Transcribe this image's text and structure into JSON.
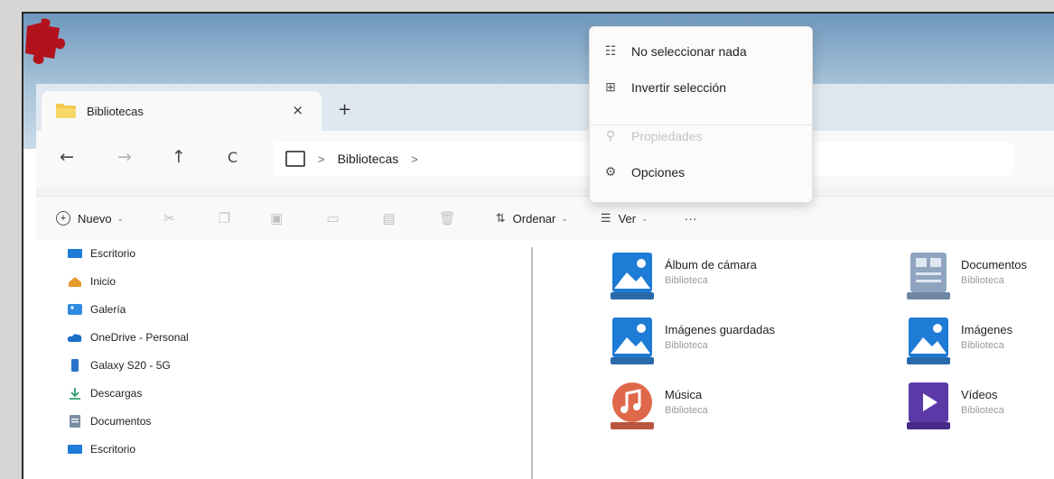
{
  "window": {
    "tab_title": "Bibliotecas",
    "tab_close": "×",
    "tab_new": "+"
  },
  "nav": {
    "back": "←",
    "forward": "→",
    "up": "↑",
    "refresh": "C",
    "breadcrumb": "Bibliotecas",
    "breadcrumb_sep": ">",
    "breadcrumb_end": ">"
  },
  "toolbar": {
    "new_label": "Nuevo",
    "sort_label": "Ordenar",
    "view_label": "Ver",
    "more_label": "···"
  },
  "context_menu": {
    "items": [
      {
        "label": "No seleccionar nada",
        "icon": "select-none-icon",
        "enabled": true
      },
      {
        "label": "Invertir selección",
        "icon": "invert-selection-icon",
        "enabled": true
      },
      {
        "label": "Propiedades",
        "icon": "properties-icon",
        "enabled": false
      },
      {
        "label": "Opciones",
        "icon": "gear-icon",
        "enabled": true
      }
    ]
  },
  "sidebar": {
    "items": [
      {
        "label": "Escritorio",
        "icon": "desktop-icon",
        "color": "#1e7bd6"
      },
      {
        "label": "Inicio",
        "icon": "home-icon",
        "color": "#e59b2b"
      },
      {
        "label": "Galería",
        "icon": "gallery-icon",
        "color": "#2f8be0"
      },
      {
        "label": "OneDrive - Personal",
        "icon": "cloud-icon",
        "color": "#1b6fc7"
      },
      {
        "label": "Galaxy S20 - 5G",
        "icon": "phone-icon",
        "color": "#2a72c9"
      },
      {
        "label": "Descargas",
        "icon": "download-icon",
        "color": "#2f9e6c"
      },
      {
        "label": "Documentos",
        "icon": "documents-icon",
        "color": "#7b8da3"
      },
      {
        "label": "Escritorio",
        "icon": "desktop-icon",
        "color": "#1e7bd6"
      }
    ]
  },
  "libraries": [
    {
      "name": "Álbum de cámara",
      "type": "Biblioteca",
      "icon": "camera-roll-icon"
    },
    {
      "name": "Documentos",
      "type": "Biblioteca",
      "icon": "documents-library-icon"
    },
    {
      "name": "Imágenes guardadas",
      "type": "Biblioteca",
      "icon": "saved-pictures-icon"
    },
    {
      "name": "Imágenes",
      "type": "Biblioteca",
      "icon": "pictures-icon"
    },
    {
      "name": "Música",
      "type": "Biblioteca",
      "icon": "music-icon"
    },
    {
      "name": "Vídeos",
      "type": "Biblioteca",
      "icon": "videos-icon"
    }
  ],
  "colors": {
    "accent": "#1e7bd6",
    "music": "#e0684a",
    "videos": "#5b3aa8"
  }
}
